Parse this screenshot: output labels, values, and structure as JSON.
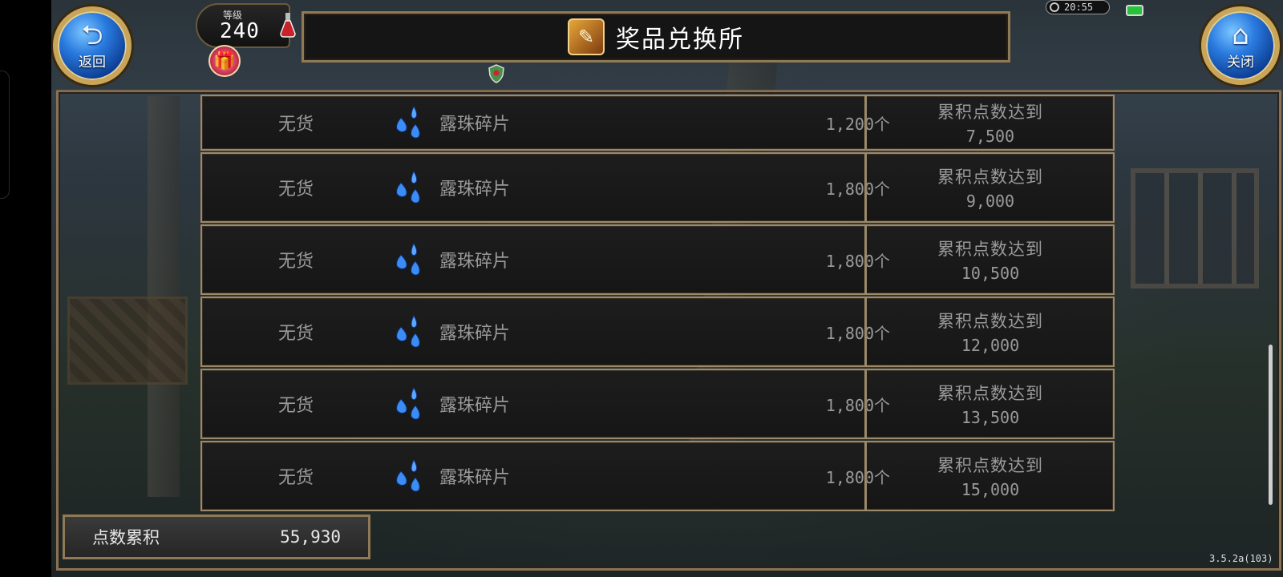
{
  "header": {
    "back_label": "返回",
    "close_label": "关闭",
    "level_label": "等级",
    "level_value": "240",
    "title": "奖品兑换所",
    "clock": "20:55"
  },
  "rewards": [
    {
      "status": "无货",
      "item": "露珠碎片",
      "qty": "1,200个",
      "cond_line1": "累积点数达到",
      "cond_line2": "7,500"
    },
    {
      "status": "无货",
      "item": "露珠碎片",
      "qty": "1,800个",
      "cond_line1": "累积点数达到",
      "cond_line2": "9,000"
    },
    {
      "status": "无货",
      "item": "露珠碎片",
      "qty": "1,800个",
      "cond_line1": "累积点数达到",
      "cond_line2": "10,500"
    },
    {
      "status": "无货",
      "item": "露珠碎片",
      "qty": "1,800个",
      "cond_line1": "累积点数达到",
      "cond_line2": "12,000"
    },
    {
      "status": "无货",
      "item": "露珠碎片",
      "qty": "1,800个",
      "cond_line1": "累积点数达到",
      "cond_line2": "13,500"
    },
    {
      "status": "无货",
      "item": "露珠碎片",
      "qty": "1,800个",
      "cond_line1": "累积点数达到",
      "cond_line2": "15,000"
    }
  ],
  "points": {
    "label": "点数累积",
    "value": "55,930"
  },
  "version": "3.5.2a(103)",
  "icons": {
    "back": "back-arrow-icon",
    "close": "home-icon",
    "item": "dewdrop-icon"
  },
  "colors": {
    "frame": "#9b8968",
    "button_blue": "#2a7be0",
    "text_gray": "#9a9a9a"
  }
}
